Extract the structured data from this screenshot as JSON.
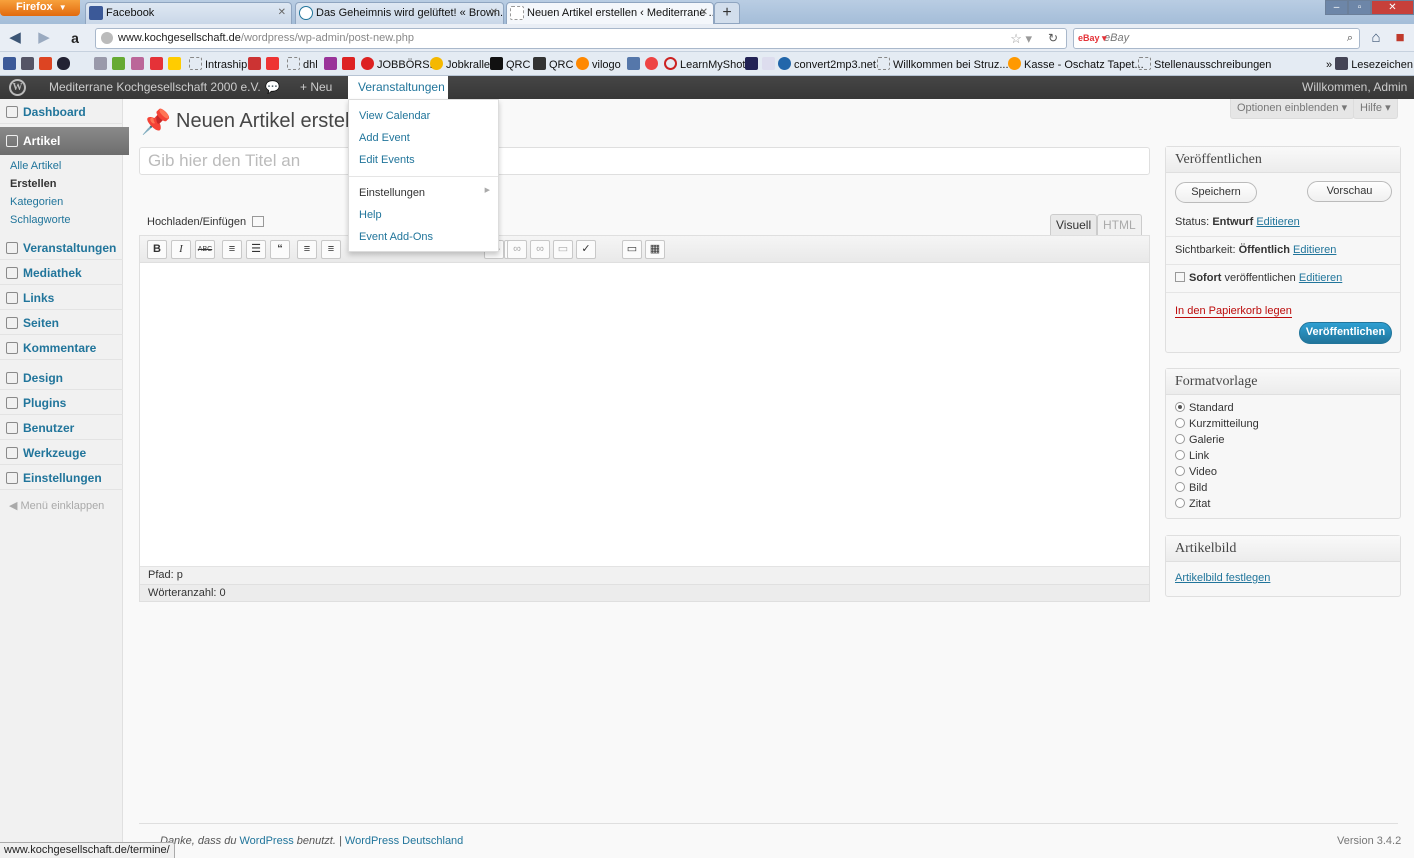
{
  "browser": {
    "menu_label": "Firefox",
    "tabs": [
      {
        "label": "Facebook"
      },
      {
        "label": "Das Geheimnis wird gelüftet! « Brown..."
      },
      {
        "label": "Neuen Artikel erstellen ‹ Mediterrane ..."
      }
    ],
    "url_domain": "www.kochgesellschaft.de",
    "url_path": "/wordpress/wp-admin/post-new.php",
    "search_engine_label": "eBay",
    "search_placeholder": "eBay",
    "bookmarks": [
      "Intraship",
      "dhl",
      "JOBBÖRSE",
      "Jobkralle",
      "QRC",
      "QRC",
      "vilogo",
      "LearnMyShot",
      "convert2mp3.net",
      "Willkommen bei Struz...",
      "Kasse - Oschatz Tapet...",
      "Stellenausschreibungen"
    ],
    "bookmarks_menu": "Lesezeichen",
    "status_url": "www.kochgesellschaft.de/termine/"
  },
  "adminbar": {
    "site_name": "Mediterrane Kochgesellschaft 2000 e.V.",
    "new_label": "Neu",
    "active_menu": "Veranstaltungen",
    "greeting": "Willkommen, Admin"
  },
  "dropdown": {
    "items": [
      "View Calendar",
      "Add Event",
      "Edit Events"
    ],
    "settings": "Einstellungen",
    "help": "Help",
    "addons": "Event Add-Ons"
  },
  "sidebar": {
    "dashboard": "Dashboard",
    "artikel": "Artikel",
    "sub": [
      "Alle Artikel",
      "Erstellen",
      "Kategorien",
      "Schlagworte"
    ],
    "items": [
      "Veranstaltungen",
      "Mediathek",
      "Links",
      "Seiten",
      "Kommentare",
      "Design",
      "Plugins",
      "Benutzer",
      "Werkzeuge",
      "Einstellungen"
    ],
    "collapse": "Menü einklappen"
  },
  "main": {
    "title": "Neuen Artikel erstellen",
    "screen_options": "Optionen einblenden",
    "help": "Hilfe",
    "title_placeholder": "Gib hier den Titel an",
    "upload_label": "Hochladen/Einfügen",
    "tab_visual": "Visuell",
    "tab_html": "HTML",
    "path_label": "Pfad:",
    "path_value": "p",
    "wordcount": "Wörteranzahl: 0"
  },
  "publish": {
    "title": "Veröffentlichen",
    "save": "Speichern",
    "preview": "Vorschau",
    "status_label": "Status:",
    "status_value": "Entwurf",
    "visibility_label": "Sichtbarkeit:",
    "visibility_value": "Öffentlich",
    "schedule_value": "Sofort",
    "schedule_label": "veröffentlichen",
    "edit": "Editieren",
    "trash": "In den Papierkorb legen",
    "publish": "Veröffentlichen"
  },
  "format": {
    "title": "Formatvorlage",
    "options": [
      "Standard",
      "Kurzmitteilung",
      "Galerie",
      "Link",
      "Video",
      "Bild",
      "Zitat"
    ]
  },
  "thumbnail": {
    "title": "Artikelbild",
    "link": "Artikelbild festlegen"
  },
  "footer": {
    "thanks_prefix": "Danke, dass du",
    "wp_link": "WordPress",
    "thanks_suffix": "benutzt. |",
    "de_link": "WordPress Deutschland",
    "version": "Version 3.4.2"
  }
}
